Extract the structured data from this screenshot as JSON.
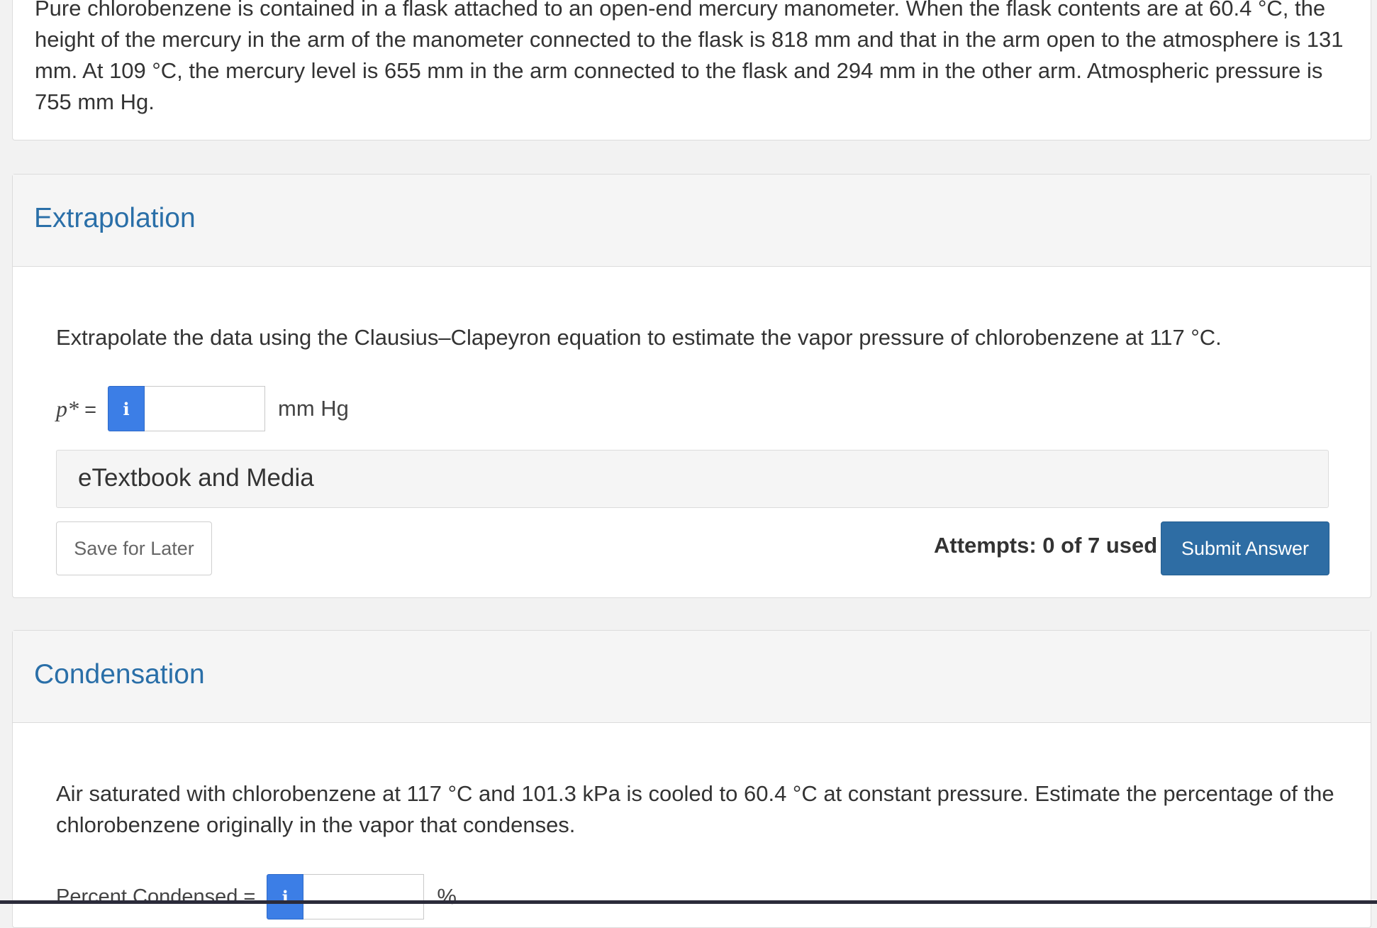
{
  "intro": {
    "text": "Pure chlorobenzene is contained in a flask attached to an open-end mercury manometer. When the flask contents are at 60.4 °C, the height of the mercury in the arm of the manometer connected to the flask is 818 mm and that in the arm open to the atmosphere is 131 mm. At 109 °C, the mercury level is 655 mm in the arm connected to the flask and 294 mm in the other arm. Atmospheric pressure is 755 mm Hg."
  },
  "extrapolation": {
    "title": "Extrapolation",
    "question": "Extrapolate the data using the Clausius–Clapeyron equation to estimate the vapor pressure of chlorobenzene at 117 °C.",
    "var_name": "p*",
    "equals": "=",
    "info_icon": "i",
    "input_value": "",
    "unit": "mm Hg",
    "media_label": "eTextbook and Media",
    "save_label": "Save for Later",
    "attempts": "Attempts: 0 of 7 used",
    "submit_label": "Submit Answer"
  },
  "condensation": {
    "title": "Condensation",
    "question": "Air saturated with chlorobenzene at 117 °C and 101.3 kPa is cooled to 60.4 °C at constant pressure. Estimate the percentage of the chlorobenzene originally in the vapor that condenses.",
    "var_label": "Percent Condensed =",
    "info_icon": "i",
    "input_value": "",
    "unit": "%"
  }
}
